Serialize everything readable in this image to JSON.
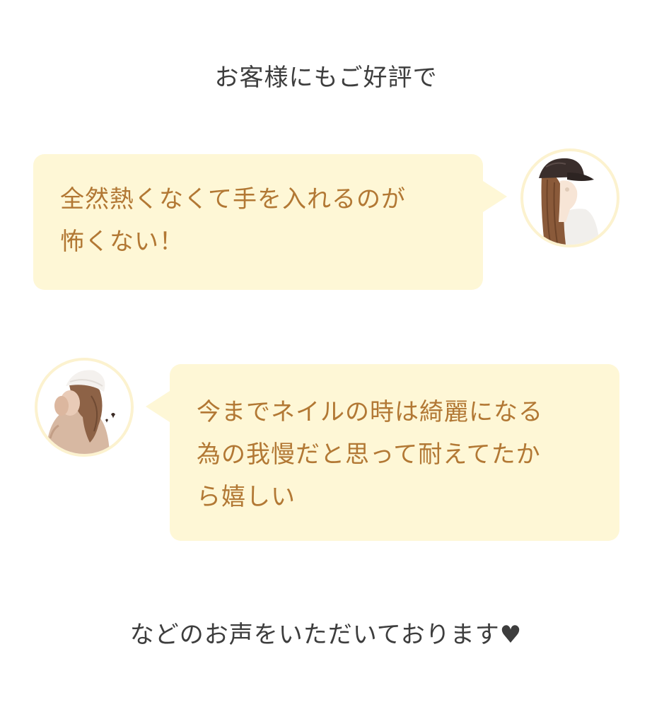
{
  "heading": "お客様にもご好評で",
  "testimonials": [
    {
      "text": "全然熱くなくて手を入れるのが\n怖くない！",
      "avatar": "woman-in-cap-illustration"
    },
    {
      "text": "今までネイルの時は綺麗になる\n為の我慢だと思って耐えてたか\nら嬉しい",
      "avatar": "woman-in-knit-hat-illustration"
    }
  ],
  "footer": "などのお声をいただいております♥",
  "colors": {
    "bubble_background": "#fef7d6",
    "bubble_text": "#b27834",
    "heading_text": "#3d3d3d",
    "avatar_border": "#fcf2cf"
  }
}
